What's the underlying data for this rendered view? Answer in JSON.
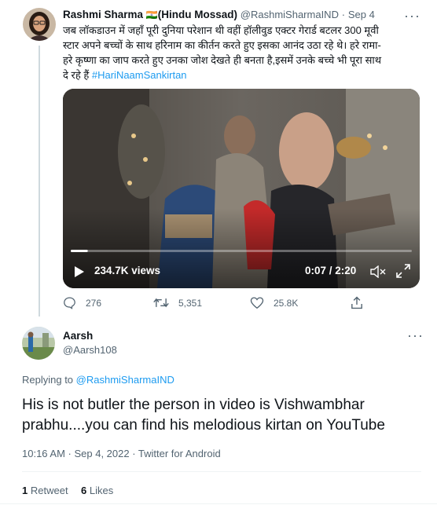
{
  "original_tweet": {
    "display_name": "Rashmi Sharma",
    "flag": "🇮🇳",
    "name_suffix": "(Hindu Mossad)",
    "handle": "@RashmiSharmaIND",
    "separator": "·",
    "date": "Sep 4",
    "text_line1": "जब लॉकडाउन में जहाँ पूरी दुनिया परेशान थी वहीं हॉलीवुड एक्टर गेरार्ड बटलर 300 मूवी",
    "text_line2": "स्टार अपने बच्चों के साथ हरिनाम का कीर्तन करते हुए इसका आनंद उठा रहे थे। हरे रामा-",
    "text_line3": "हरे कृष्णा का जाप करते हुए उनका जोश देखते ही बनता है,इसमें उनके बच्चे भी पूरा साथ",
    "text_line4": "दे रहे हैं",
    "hashtag": "#HariNaamSankirtan",
    "video": {
      "views": "234.7K views",
      "time": "0:07 / 2:20",
      "progress": 0.05
    },
    "actions": {
      "replies": "276",
      "retweets": "5,351",
      "likes": "25.8K"
    }
  },
  "reply_tweet": {
    "display_name": "Aarsh",
    "handle": "@Aarsh108",
    "replying_to_label": "Replying to",
    "replying_to_handle": "@RashmiSharmaIND",
    "text_line1": "His is not butler the person in video is Vishwambhar",
    "text_line2": "prabhu....you can find his melodious kirtan on YouTube",
    "timestamp": "10:16 AM · Sep 4, 2022 · Twitter for Android",
    "retweets_count": "1",
    "retweets_label": "Retweet",
    "likes_count": "6",
    "likes_label": "Likes"
  },
  "icons": [
    "more-icon",
    "play-icon",
    "mute-icon",
    "fullscreen-icon",
    "reply-icon",
    "retweet-icon",
    "like-icon",
    "share-icon"
  ],
  "colors": {
    "link": "#1d9bf0",
    "muted": "#536471",
    "text": "#0f1419"
  }
}
